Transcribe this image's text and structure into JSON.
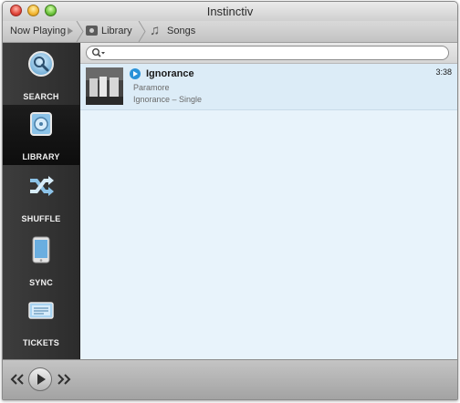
{
  "window": {
    "title": "Instinctiv"
  },
  "breadcrumb": {
    "now_playing": "Now Playing",
    "library": "Library",
    "songs": "Songs"
  },
  "search": {
    "value": "",
    "placeholder": ""
  },
  "sidebar": {
    "items": [
      {
        "label": "SEARCH",
        "icon": "search-icon",
        "active": false
      },
      {
        "label": "LIBRARY",
        "icon": "library-icon",
        "active": true
      },
      {
        "label": "SHUFFLE",
        "icon": "shuffle-icon",
        "active": false
      },
      {
        "label": "SYNC",
        "icon": "sync-icon",
        "active": false
      },
      {
        "label": "TICKETS",
        "icon": "tickets-icon",
        "active": false
      }
    ]
  },
  "songs": [
    {
      "title": "Ignorance",
      "artist": "Paramore",
      "album": "Ignorance – Single",
      "duration": "3:38"
    }
  ],
  "player": {
    "controls": [
      "previous-icon",
      "play-icon",
      "next-icon"
    ]
  },
  "colors": {
    "accent": "#2a92d8",
    "sidebar": "#333333",
    "list_bg": "#e8f3fb",
    "selected_row": "#dcecf7"
  }
}
